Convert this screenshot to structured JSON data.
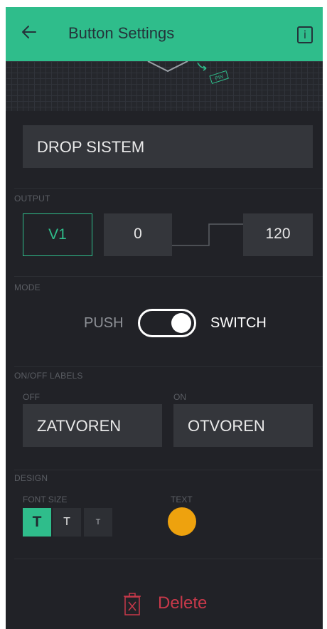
{
  "header": {
    "title": "Button Settings",
    "back_icon": "arrow-left-icon",
    "info_icon": "info-icon",
    "info_glyph": "i",
    "bg": "#2fbd8b"
  },
  "preview": {
    "pin_label": "PIN"
  },
  "name_field": {
    "value": "DROP SISTEM"
  },
  "output": {
    "section_label": "OUTPUT",
    "pin": "V1",
    "low": "0",
    "high": "120"
  },
  "mode": {
    "section_label": "MODE",
    "left": "PUSH",
    "right": "SWITCH",
    "selected": "SWITCH"
  },
  "labels": {
    "section_label": "ON/OFF LABELS",
    "off_caption": "OFF",
    "on_caption": "ON",
    "off_value": "ZATVOREN",
    "on_value": "OTVOREN"
  },
  "design": {
    "section_label": "DESIGN",
    "font_size_label": "FONT SIZE",
    "sizes": [
      "T",
      "T",
      "T"
    ],
    "selected_size_index": 0,
    "text_label": "TEXT",
    "text_color": "#eea20e"
  },
  "delete": {
    "label": "Delete",
    "color": "#c8394a",
    "icon": "trash-icon"
  }
}
